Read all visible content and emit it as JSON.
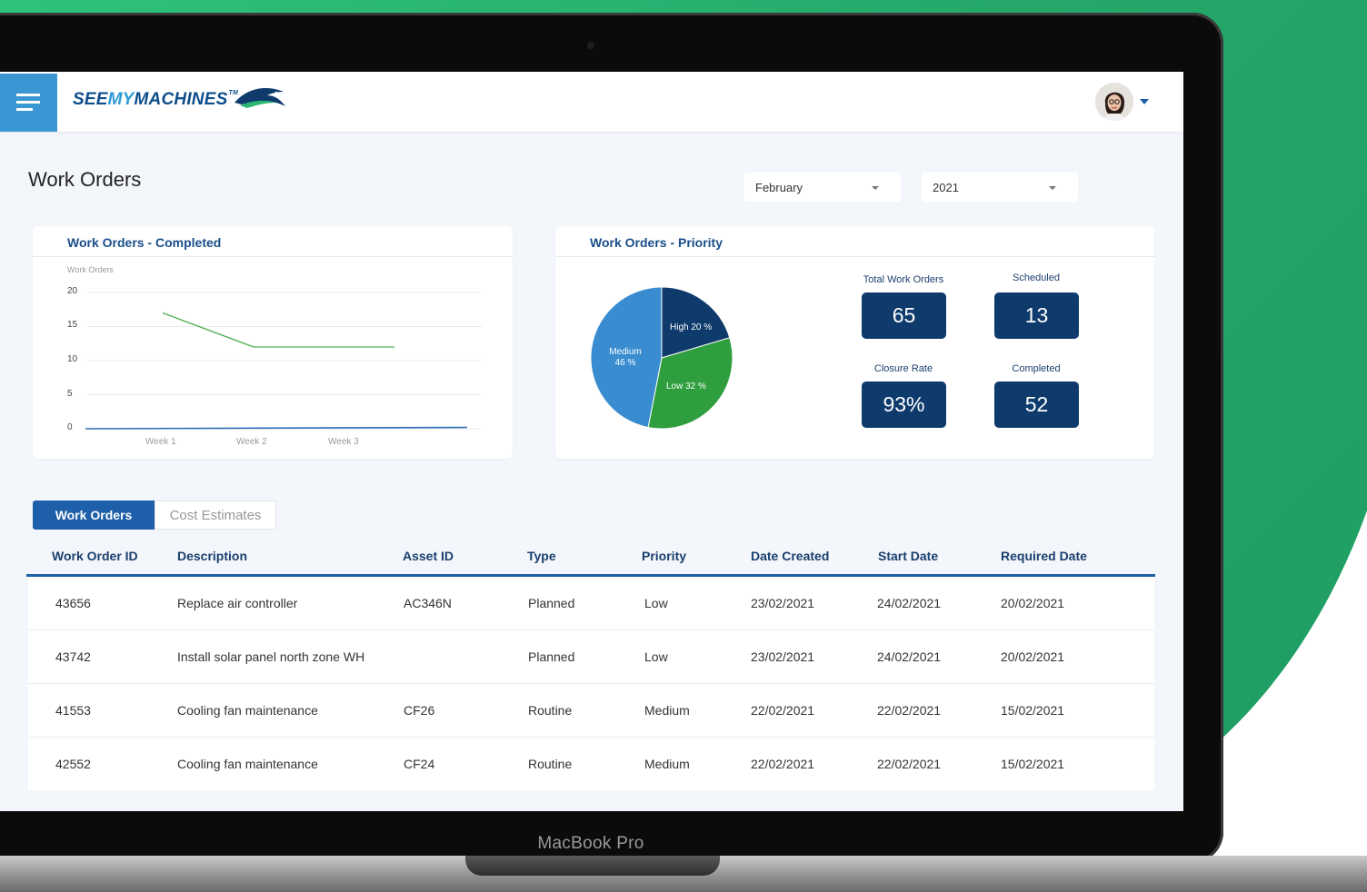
{
  "device": {
    "brand_label": "MacBook Pro"
  },
  "header": {
    "logo_see": "SEE",
    "logo_my": "MY",
    "logo_machines": "MACHINES",
    "logo_tm": "TM"
  },
  "page": {
    "title": "Work Orders"
  },
  "filters": {
    "month": "February",
    "year": "2021"
  },
  "completed_card": {
    "title": "Work Orders - Completed",
    "ylabel": "Work Orders"
  },
  "priority_card": {
    "title": "Work Orders - Priority",
    "pie_labels": {
      "high": "High 20 %",
      "medium_line1": "Medium",
      "medium_line2": "46 %",
      "low": "Low 32 %"
    },
    "stats": {
      "total_label": "Total Work Orders",
      "total_value": "65",
      "scheduled_label": "Scheduled",
      "scheduled_value": "13",
      "closure_label": "Closure Rate",
      "closure_value": "93%",
      "completed_label": "Completed",
      "completed_value": "52"
    }
  },
  "chart_data": [
    {
      "type": "line",
      "title": "Work Orders - Completed",
      "ylabel": "Work Orders",
      "xlabel": "",
      "categories": [
        "Week 1",
        "Week 2",
        "Week 3"
      ],
      "yticks": [
        "20",
        "15",
        "10",
        "5",
        "0"
      ],
      "ylim": [
        0,
        20
      ],
      "grid": true,
      "series": [
        {
          "color": "#4caf50",
          "points": [
            [
              0.85,
              17
            ],
            [
              1.85,
              12
            ],
            [
              3.4,
              12
            ]
          ]
        },
        {
          "color": "#2d6fb5",
          "points": [
            [
              0,
              0
            ],
            [
              4.2,
              0.2
            ]
          ]
        }
      ]
    },
    {
      "type": "pie",
      "title": "Work Orders - Priority",
      "series": [
        {
          "name": "High",
          "value": 20,
          "color": "#0e3b6c"
        },
        {
          "name": "Low",
          "value": 32,
          "color": "#2e9e3e"
        },
        {
          "name": "Medium",
          "value": 46,
          "color": "#3a8cd0"
        }
      ]
    }
  ],
  "tabs": {
    "work_orders": "Work Orders",
    "cost_estimates": "Cost Estimates"
  },
  "table": {
    "headers": [
      "Work Order ID",
      "Description",
      "Asset ID",
      "Type",
      "Priority",
      "Date Created",
      "Start Date",
      "Required Date"
    ],
    "rows": [
      [
        "43656",
        "Replace air controller",
        "AC346N",
        "Planned",
        "Low",
        "23/02/2021",
        "24/02/2021",
        "20/02/2021"
      ],
      [
        "43742",
        "Install solar panel north zone WH",
        "",
        "Planned",
        "Low",
        "23/02/2021",
        "24/02/2021",
        "20/02/2021"
      ],
      [
        "41553",
        "Cooling fan maintenance",
        "CF26",
        "Routine",
        "Medium",
        "22/02/2021",
        "22/02/2021",
        "15/02/2021"
      ],
      [
        "42552",
        "Cooling fan maintenance",
        "CF24",
        "Routine",
        "Medium",
        "22/02/2021",
        "22/02/2021",
        "15/02/2021"
      ]
    ]
  }
}
